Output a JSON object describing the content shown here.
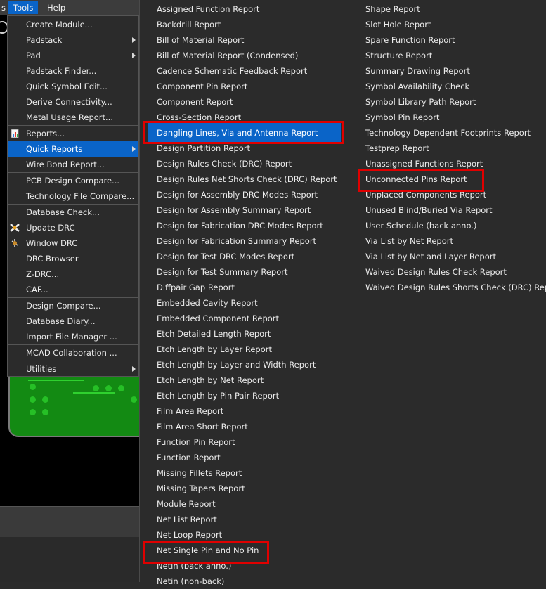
{
  "menubar": {
    "partial_label": "s",
    "tools_label": "Tools",
    "help_label": "Help"
  },
  "tools_menu": {
    "items": [
      {
        "label": "Create Module..."
      },
      {
        "label": "Padstack",
        "submenu": true
      },
      {
        "label": "Pad",
        "submenu": true
      },
      {
        "label": "Padstack Finder..."
      },
      {
        "label": "Quick Symbol Edit..."
      },
      {
        "label": "Derive Connectivity..."
      },
      {
        "label": "Metal Usage Report..."
      },
      {
        "label": "Reports...",
        "icon": "reports-icon"
      },
      {
        "label": "Quick Reports",
        "submenu": true,
        "active": true
      },
      {
        "label": "Wire Bond Report..."
      },
      {
        "label": "PCB Design Compare..."
      },
      {
        "label": "Technology File Compare..."
      },
      {
        "label": "Database Check..."
      },
      {
        "label": "Update DRC",
        "icon": "update-drc-icon"
      },
      {
        "label": "Window DRC",
        "icon": "window-drc-icon"
      },
      {
        "label": "DRC Browser"
      },
      {
        "label": "Z-DRC..."
      },
      {
        "label": "CAF..."
      },
      {
        "label": "Design Compare..."
      },
      {
        "label": "Database Diary..."
      },
      {
        "label": "Import File Manager ..."
      },
      {
        "label": "MCAD Collaboration ..."
      },
      {
        "label": "Utilities",
        "submenu": true
      }
    ]
  },
  "quick_reports": {
    "column1": [
      "Assigned Function Report",
      "Backdrill Report",
      "Bill of Material Report",
      "Bill of Material Report (Condensed)",
      "Cadence Schematic Feedback Report",
      "Component Pin Report",
      "Component Report",
      "Cross-Section Report",
      "Dangling Lines, Via and Antenna Report",
      "Design Partition Report",
      "Design Rules Check (DRC) Report",
      "Design Rules Net Shorts Check (DRC) Report",
      "Design for Assembly DRC Modes Report",
      "Design for Assembly Summary Report",
      "Design for Fabrication DRC Modes Report",
      "Design for Fabrication Summary Report",
      "Design for Test DRC Modes Report",
      "Design for Test Summary Report",
      "Diffpair Gap Report",
      "Embedded Cavity Report",
      "Embedded Component Report",
      "Etch Detailed Length Report",
      "Etch Length by Layer Report",
      "Etch Length by Layer and Width Report",
      "Etch Length by Net Report",
      "Etch Length by Pin Pair Report",
      "Film Area Report",
      "Film Area Short Report",
      "Function Pin Report",
      "Function Report",
      "Missing Fillets Report",
      "Missing Tapers Report",
      "Module Report",
      "Net List Report",
      "Net Loop Report",
      "Net Single Pin and No Pin",
      "Netin (back anno.)",
      "Netin (non-back)"
    ],
    "column2": [
      "Shape Report",
      "Slot Hole Report",
      "Spare Function Report",
      "Structure Report",
      "Summary Drawing Report",
      "Symbol Availability Check",
      "Symbol Library Path Report",
      "Symbol Pin Report",
      "Technology Dependent Footprints Report",
      "Testprep Report",
      "Unassigned Functions Report",
      "Unconnected Pins Report",
      "Unplaced Components Report",
      "Unused Blind/Buried Via Report",
      "User Schedule (back anno.)",
      "Via List by Net Report",
      "Via List by Net and Layer Report",
      "Waived Design Rules Check Report",
      "Waived Design Rules Shorts Check (DRC) Report"
    ],
    "selected": "Dangling Lines, Via and Antenna Report"
  },
  "colors": {
    "highlight": "#0a64c8",
    "annotation_red": "#e00000",
    "menu_bg": "#2b2b2b"
  }
}
